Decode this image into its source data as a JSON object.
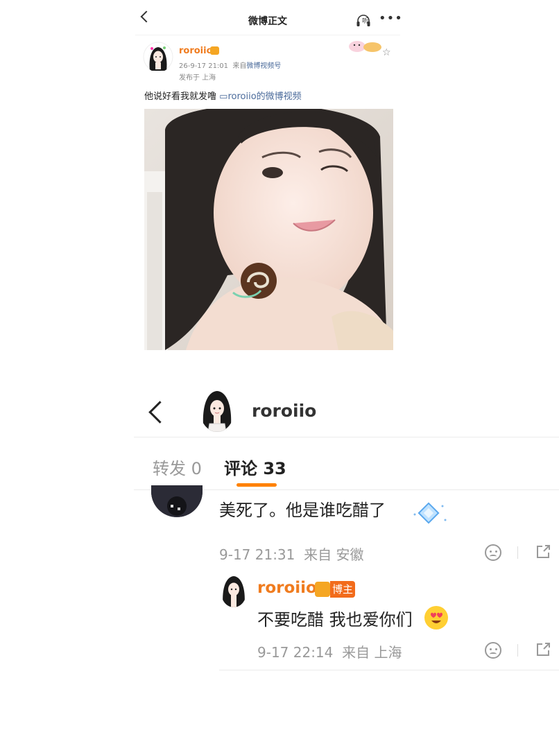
{
  "top_post": {
    "title": "微博正文",
    "listen_label": "听",
    "more_icon": "more-dots-icon",
    "author": "roroiio",
    "time": "26-9-17 21:01",
    "source_prefix": "来自",
    "source": "微博视频号",
    "location": "发布于 上海",
    "text": "他说好看我就发噜",
    "video_link": "roroiio的微博视频",
    "photo_alt": "selfie-photo"
  },
  "detail": {
    "username": "roroiio",
    "tabs": [
      {
        "label": "转发 0",
        "active": false
      },
      {
        "label": "评论 33",
        "active": true
      }
    ],
    "accent_color": "#ff8200",
    "comments": [
      {
        "text": "美死了。他是谁吃醋了",
        "time": "9-17 21:31",
        "source": "来自 安徽"
      }
    ],
    "reply": {
      "author": "roroiio",
      "badge": "博主",
      "text": "不要吃醋 我也爱你们",
      "time": "9-17 22:14",
      "source": "来自 上海"
    }
  }
}
